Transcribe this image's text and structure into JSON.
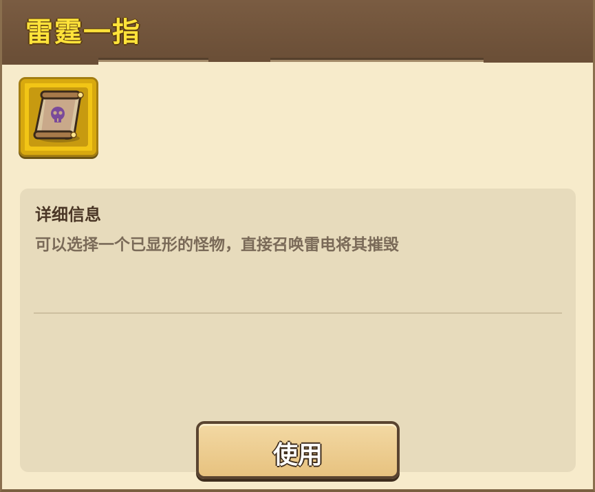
{
  "dialog": {
    "title": "雷霆一指"
  },
  "item": {
    "icon": "scroll-skull-icon"
  },
  "details": {
    "heading": "详细信息",
    "description": "可以选择一个已显形的怪物，直接召唤雷电将其摧毁"
  },
  "actions": {
    "use_label": "使用"
  },
  "colors": {
    "header": "#6b4f37",
    "title": "#ffe33a",
    "panel": "#f7ebcb",
    "slot": "#f2c516",
    "button": "#e7c27f"
  }
}
